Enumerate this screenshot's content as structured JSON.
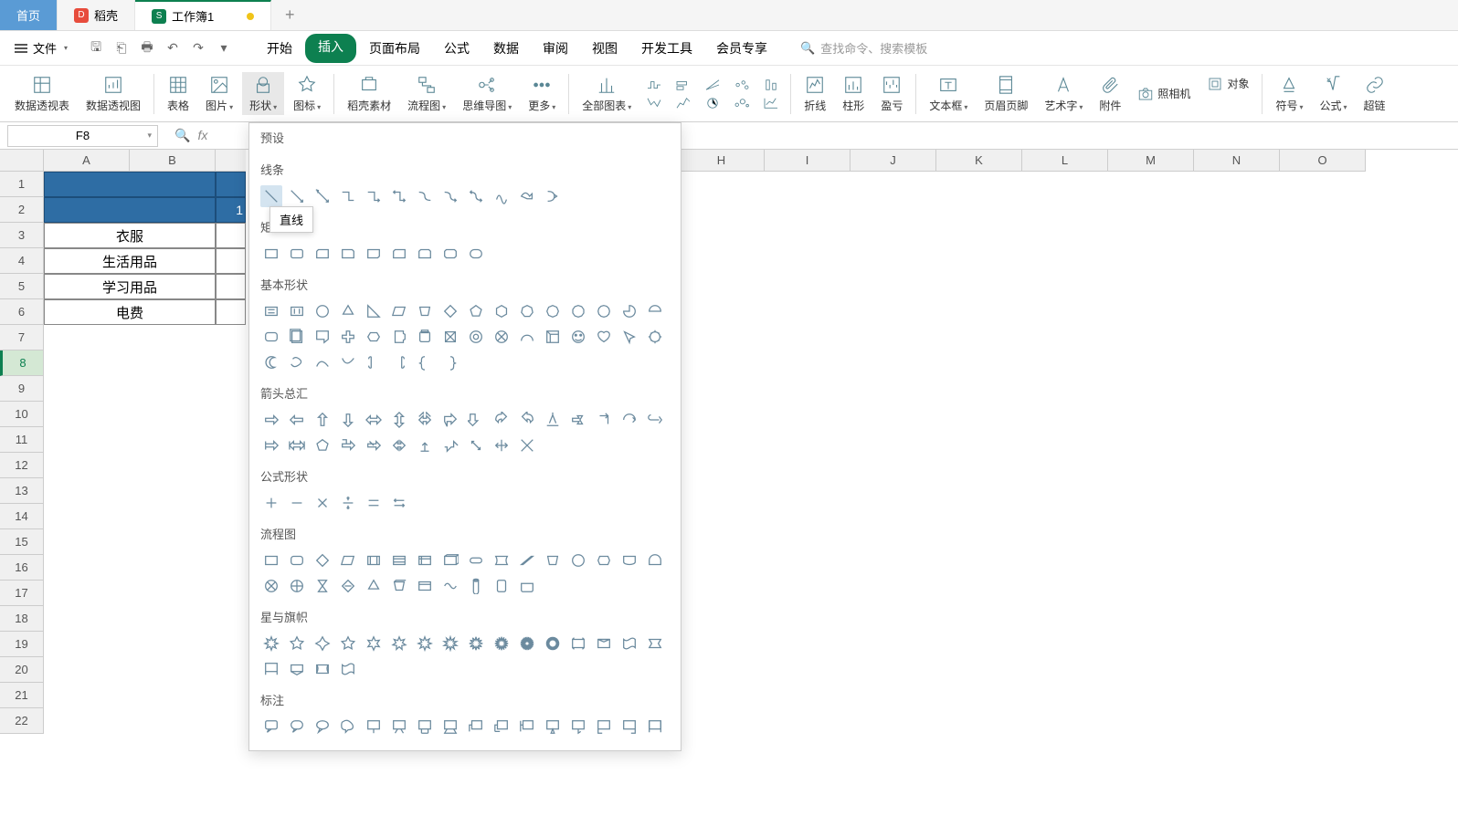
{
  "tabs": {
    "home": "首页",
    "doke": "稻壳",
    "workbook": "工作簿1"
  },
  "file_menu": "文件",
  "menu_tabs": [
    "开始",
    "插入",
    "页面布局",
    "公式",
    "数据",
    "审阅",
    "视图",
    "开发工具",
    "会员专享"
  ],
  "active_menu_tab": 1,
  "search_placeholder": "查找命令、搜索模板",
  "ribbon": {
    "pivot_table": "数据透视表",
    "pivot_chart": "数据透视图",
    "table": "表格",
    "picture": "图片",
    "shapes": "形状",
    "icons": "图标",
    "material": "稻壳素材",
    "flowchart": "流程图",
    "mindmap": "思维导图",
    "more": "更多",
    "all_charts": "全部图表",
    "line_chart": "折线",
    "bar_chart": "柱形",
    "profit": "盈亏",
    "textbox": "文本框",
    "header_footer": "页眉页脚",
    "wordart": "艺术字",
    "attachment": "附件",
    "camera": "照相机",
    "object": "对象",
    "symbol": "符号",
    "formula": "公式",
    "hyper": "超链"
  },
  "cell_reference": "F8",
  "columns": [
    "A",
    "B",
    "H",
    "I",
    "J",
    "K",
    "L",
    "M",
    "N",
    "O"
  ],
  "rows": [
    "1",
    "2",
    "3",
    "4",
    "5",
    "6",
    "7",
    "8",
    "9",
    "10",
    "11",
    "12",
    "13",
    "14",
    "15",
    "16",
    "17",
    "18",
    "19",
    "20",
    "21",
    "22"
  ],
  "data_cells": {
    "a3": "衣服",
    "a4": "生活用品",
    "a5": "学习用品",
    "a6": "电费",
    "b2_partial": "1"
  },
  "shapes_popup": {
    "presets": "预设",
    "lines": "线条",
    "rectangles": "矩",
    "basic": "基本形状",
    "arrows": "箭头总汇",
    "equation": "公式形状",
    "flowchart": "流程图",
    "stars": "星与旗帜",
    "callouts": "标注"
  },
  "tooltip": "直线"
}
